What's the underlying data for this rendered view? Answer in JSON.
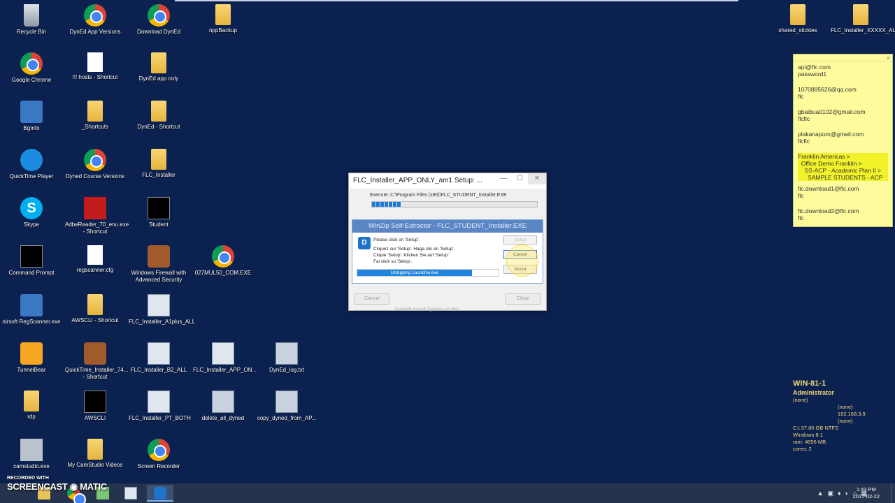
{
  "desktop": {
    "icons": [
      {
        "label": "Recycle Bin",
        "icon": "recycle-bin-icon"
      },
      {
        "label": "DynEd App Versions",
        "icon": "chrome-icon"
      },
      {
        "label": "Download DynEd",
        "icon": "chrome-icon"
      },
      {
        "label": "nppBackup",
        "icon": "folder-icon"
      },
      {
        "label": "Google Chrome",
        "icon": "chrome-icon"
      },
      {
        "label": "!!! hosts - Shortcut",
        "icon": "document-icon"
      },
      {
        "label": "DynEd app only",
        "icon": "folder-icon"
      },
      {
        "label": "BgInfo",
        "icon": "bginfo-icon"
      },
      {
        "label": "_Shortcuts",
        "icon": "folder-icon"
      },
      {
        "label": "DynEd - Shortcut",
        "icon": "folder-icon"
      },
      {
        "label": "QuickTime Player",
        "icon": "quicktime-icon"
      },
      {
        "label": "Dyned Course Versions",
        "icon": "chrome-icon"
      },
      {
        "label": "FLC_Installer",
        "icon": "folder-icon"
      },
      {
        "label": "Skype",
        "icon": "skype-icon"
      },
      {
        "label": "AdbeReader_70_enu.exe - Shortcut",
        "icon": "adobe-icon"
      },
      {
        "label": "Student",
        "icon": "flc-student-icon"
      },
      {
        "label": "Command Prompt",
        "icon": "cmd-icon"
      },
      {
        "label": "regscanner.cfg",
        "icon": "document-icon"
      },
      {
        "label": "Windows Firewall with Advanced Security",
        "icon": "firewall-icon"
      },
      {
        "label": "027MUL50_COM.EXE",
        "icon": "chrome-icon"
      },
      {
        "label": "nirsoft RegScanner.exe",
        "icon": "regscanner-icon"
      },
      {
        "label": "AWSCLI - Shortcut",
        "icon": "folder-icon"
      },
      {
        "label": "FLC_Installer_A1plus_ALL",
        "icon": "installer-icon"
      },
      {
        "label": "TunnelBear",
        "icon": "tunnelbear-icon"
      },
      {
        "label": "QuickTime_Installer_74... - Shortcut",
        "icon": "quicktime-installer-icon"
      },
      {
        "label": "FLC_Installer_B2_ALL",
        "icon": "installer-icon"
      },
      {
        "label": "FLC_Installer_APP_ON...",
        "icon": "installer-icon"
      },
      {
        "label": "DynEd_log.txt",
        "icon": "notepad-icon"
      },
      {
        "label": "rdp",
        "icon": "folder-icon"
      },
      {
        "label": "AWSCLI",
        "icon": "cmd-icon"
      },
      {
        "label": "FLC_Installer_PT_BOTH",
        "icon": "installer-icon"
      },
      {
        "label": "delete_all_dyned",
        "icon": "script-icon"
      },
      {
        "label": "copy_dyned_from_AP...",
        "icon": "script-icon"
      },
      {
        "label": "camstudio.exe",
        "icon": "camstudio-icon"
      },
      {
        "label": "My CamStudio Videos",
        "icon": "folder-icon"
      },
      {
        "label": "Screen Recorder",
        "icon": "chrome-icon"
      },
      {
        "label": "shared_stickies",
        "icon": "folder-icon"
      },
      {
        "label": "FLC_Installer_XXXXX_ALL",
        "icon": "folder-icon"
      }
    ]
  },
  "sticky": {
    "lines": [
      "api@flc.com",
      "password1",
      "",
      "1070885626@qq.com",
      "flc",
      "",
      "gbaibua0102@gmail.com",
      "flcflc",
      "",
      "plakanaporn@gmail.com",
      "flcflc",
      ""
    ],
    "highlight": [
      "Franklin Americas >",
      "  Office Demo Franklin >",
      "    SS-ACP - Academic Plan II >",
      "      SAMPLE STUDENTS - ACP"
    ],
    "lines2": [
      "flc.download1@flc.com",
      "flc",
      "",
      "flc.download2@flc.com",
      "flc"
    ],
    "close": "×"
  },
  "installer": {
    "title": "FLC_Installer_APP_ONLY_am1 Setup: ...",
    "minimize": "—",
    "maximize": "☐",
    "close": "✕",
    "execute": "Execute: C:\\Program Files (x86)\\FLC_STUDENT_Installer.EXE",
    "cancel": "Cancel",
    "nsis": "Nullsoft Install System v3.0b2",
    "close_btn": "Close",
    "progress": 0.18
  },
  "winzip": {
    "title": "WinZip Self-Extractor - FLC_STUDENT_Installer.EXE",
    "logo": "D",
    "msg1": "Please click on 'Setup'.",
    "msg2": "Cliquez sur 'Setup'.  Haga clic en 'Setup'.",
    "msg3": "Clique 'Setup'.  Klicken Sie auf 'Setup'.",
    "msg4": "Fai click su 'Setup'.",
    "unzip": "Unzipping Launchw.exe",
    "unzip_progress": 0.81,
    "setup": "Setup",
    "cancel": "Cancel",
    "about": "About"
  },
  "bginfo": {
    "host": "WIN-81-1",
    "user": "Administrator",
    "l1": "(none)",
    "l2": "(none)",
    "l3": "192.168.3.9",
    "l4": "(none)",
    "l5": "C:\\ 37.80 GB NTFS",
    "l6": "Windows 8.1",
    "l7": "ram:      4096 MB",
    "l8": "cores:  2"
  },
  "watermark": {
    "s1": "RECORDED WITH",
    "s2": "SCREENCAST ◉ MATIC"
  },
  "clock": {
    "time": "1:43 PM",
    "date": "2017-02-22"
  },
  "tray": {
    "up": "▲",
    "i1": "▣",
    "i2": "♦",
    "i3": "◐",
    "i4": "⌂",
    "i5": "▦"
  }
}
